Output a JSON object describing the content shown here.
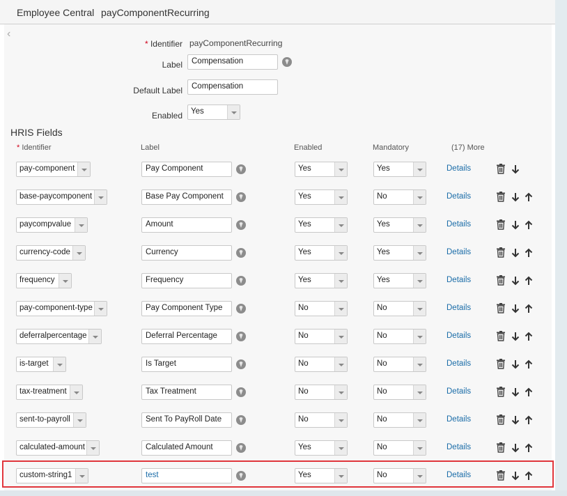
{
  "header": {
    "app_title": "Employee Central",
    "object_title": "payComponentRecurring"
  },
  "form": {
    "identifier_label": "Identifier",
    "identifier_required_mark": "*",
    "identifier_value": "payComponentRecurring",
    "label_label": "Label",
    "label_value": "Compensation",
    "default_label_label": "Default Label",
    "default_label_value": "Compensation",
    "enabled_label": "Enabled",
    "enabled_value": "Yes"
  },
  "hris": {
    "section_title": "HRIS Fields",
    "columns": {
      "required_mark": "*",
      "identifier": "Identifier",
      "label": "Label",
      "enabled": "Enabled",
      "mandatory": "Mandatory",
      "more": "(17) More"
    },
    "details_label": "Details",
    "rows": [
      {
        "identifier": "pay-component",
        "label": "Pay Component",
        "enabled": "Yes",
        "mandatory": "Yes",
        "up": false
      },
      {
        "identifier": "base-paycomponent",
        "label": "Base Pay Component",
        "enabled": "Yes",
        "mandatory": "No",
        "up": true
      },
      {
        "identifier": "paycompvalue",
        "label": "Amount",
        "enabled": "Yes",
        "mandatory": "Yes",
        "up": true
      },
      {
        "identifier": "currency-code",
        "label": "Currency",
        "enabled": "Yes",
        "mandatory": "Yes",
        "up": true
      },
      {
        "identifier": "frequency",
        "label": "Frequency",
        "enabled": "Yes",
        "mandatory": "Yes",
        "up": true
      },
      {
        "identifier": "pay-component-type",
        "label": "Pay Component Type",
        "enabled": "No",
        "mandatory": "No",
        "up": true
      },
      {
        "identifier": "deferralpercentage",
        "label": "Deferral Percentage",
        "enabled": "No",
        "mandatory": "No",
        "up": true
      },
      {
        "identifier": "is-target",
        "label": "Is Target",
        "enabled": "No",
        "mandatory": "No",
        "up": true
      },
      {
        "identifier": "tax-treatment",
        "label": "Tax Treatment",
        "enabled": "No",
        "mandatory": "No",
        "up": true
      },
      {
        "identifier": "sent-to-payroll",
        "label": "Sent To PayRoll Date",
        "enabled": "No",
        "mandatory": "No",
        "up": true
      },
      {
        "identifier": "calculated-amount",
        "label": "Calculated Amount",
        "enabled": "Yes",
        "mandatory": "No",
        "up": true
      },
      {
        "identifier": "custom-string1",
        "label": "test",
        "enabled": "Yes",
        "mandatory": "No",
        "up": true,
        "highlighted": true
      }
    ]
  },
  "colors": {
    "link": "#1a6ca8",
    "highlight_border": "#e0353b",
    "required": "#d0021b"
  }
}
